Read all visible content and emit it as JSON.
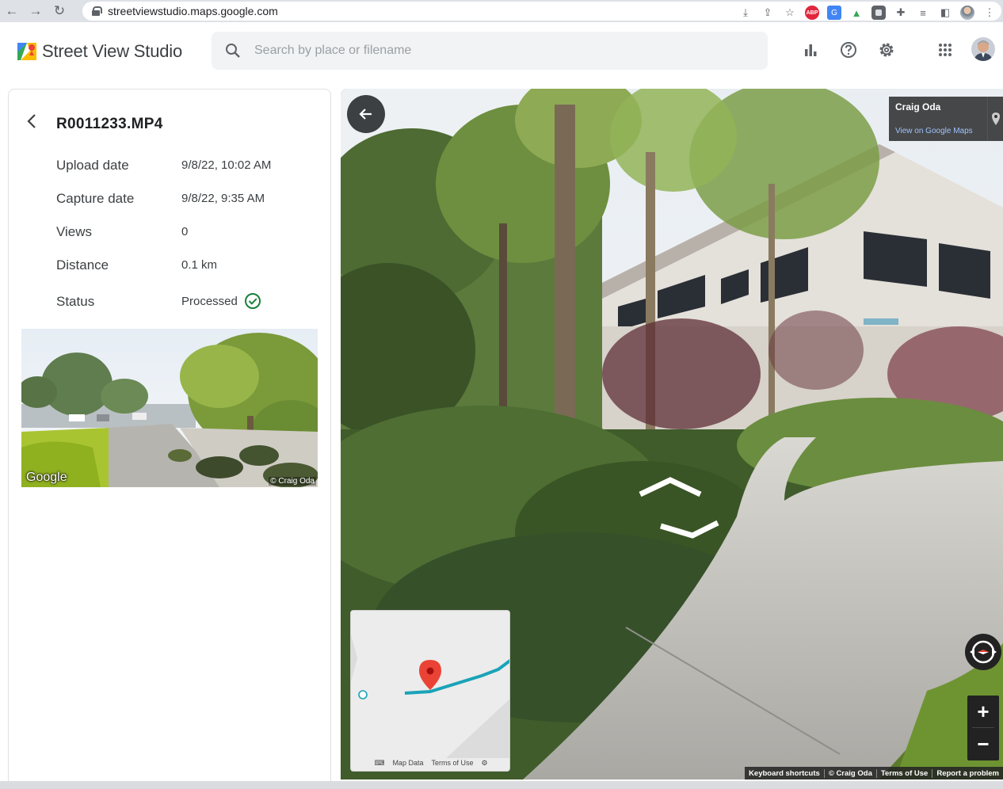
{
  "browser": {
    "url": "streetviewstudio.maps.google.com"
  },
  "header": {
    "app_title": "Street View Studio",
    "search_placeholder": "Search by place or filename",
    "icons": [
      "bar-chart-icon",
      "help-icon",
      "settings-icon",
      "apps-grid-icon"
    ]
  },
  "panel": {
    "file_title": "R0011233.MP4",
    "rows": [
      {
        "label": "Upload date",
        "value": "9/8/22, 10:02 AM"
      },
      {
        "label": "Capture date",
        "value": "9/8/22, 9:35 AM"
      },
      {
        "label": "Views",
        "value": "0"
      },
      {
        "label": "Distance",
        "value": "0.1 km"
      },
      {
        "label": "Status",
        "value": "Processed"
      }
    ],
    "thumbnail": {
      "watermark": "Google",
      "copyright": "© Craig Oda"
    }
  },
  "streetview": {
    "owner_name": "Craig Oda",
    "owner_link": "View on Google Maps",
    "minimap": {
      "map_data": "Map Data",
      "terms": "Terms of Use"
    },
    "footer": {
      "shortcuts": "Keyboard shortcuts",
      "copyright": "© Craig Oda",
      "terms": "Terms of Use",
      "report": "Report a problem"
    },
    "zoom_in": "+",
    "zoom_out": "−"
  },
  "colors": {
    "accent_blue": "#1a73e8",
    "status_green": "#188038",
    "pin_red": "#ea4335",
    "route_teal": "#1aa3b8"
  }
}
